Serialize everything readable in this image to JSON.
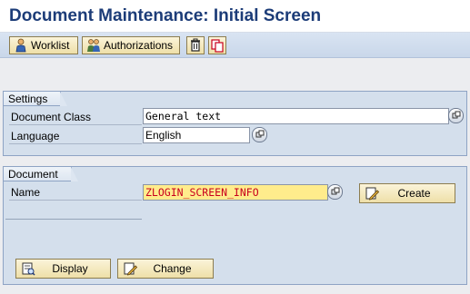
{
  "title": "Document Maintenance: Initial Screen",
  "toolbar": {
    "worklist_label": "Worklist",
    "authorizations_label": "Authorizations"
  },
  "settings": {
    "group_title": "Settings",
    "document_class_label": "Document Class",
    "document_class_value": "General text",
    "language_label": "Language",
    "language_value": "English"
  },
  "document": {
    "group_title": "Document",
    "name_label": "Name",
    "name_value": "ZLOGIN_SCREEN_INFO",
    "create_label": "Create",
    "display_label": "Display",
    "change_label": "Change"
  },
  "colors": {
    "title": "#1c3c78",
    "button_fill": "#f5e8b8",
    "highlight_field": "#ffec8c",
    "highlight_text": "#c8001e",
    "group_fill": "#d4dfec"
  },
  "icons": [
    "worklist-icon",
    "authorizations-icon",
    "delete-icon",
    "copy-icon",
    "value-help-icon",
    "create-icon",
    "display-icon",
    "change-icon"
  ]
}
